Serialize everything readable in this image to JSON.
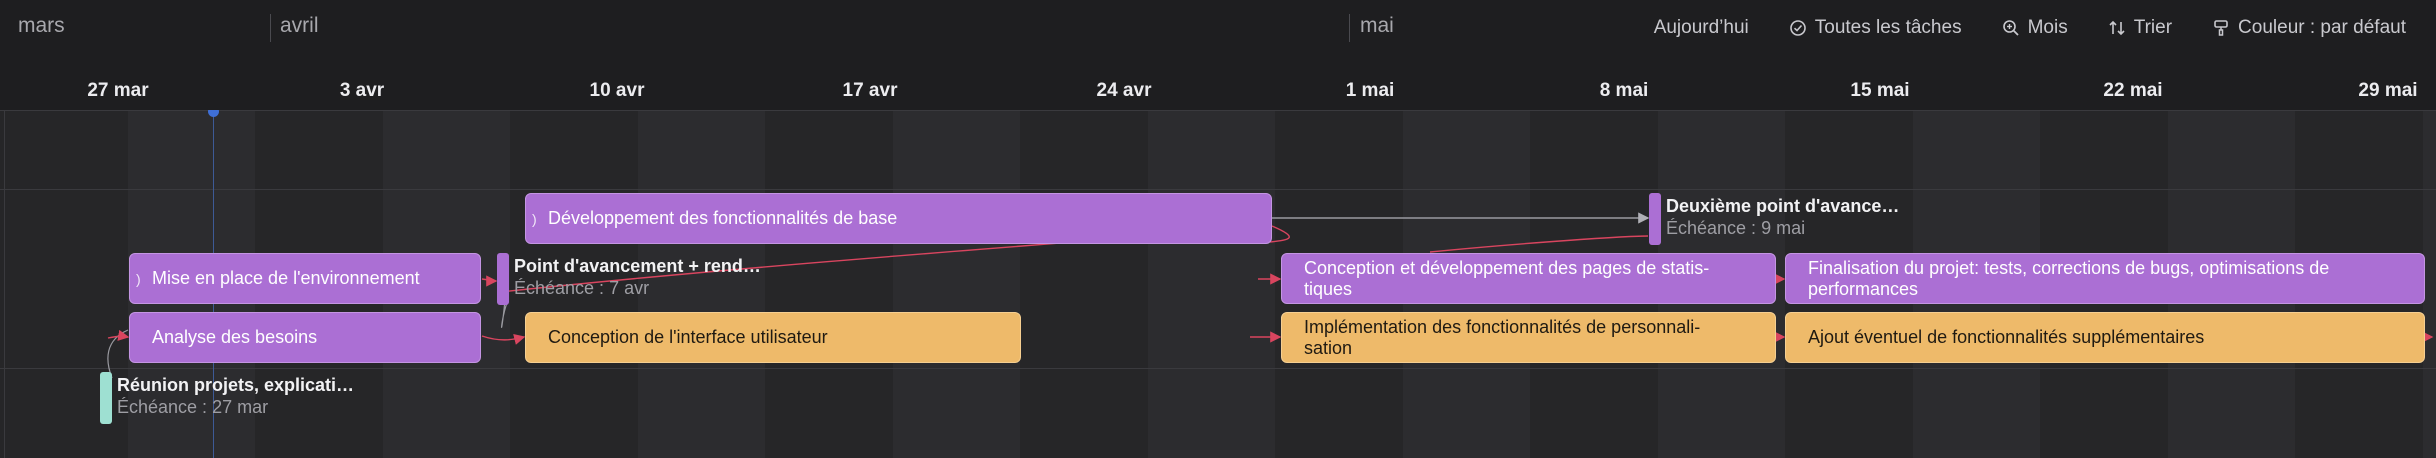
{
  "months": [
    {
      "label": "mars"
    },
    {
      "label": "avril"
    },
    {
      "label": "mai"
    }
  ],
  "toolbar": {
    "today": "Aujourd’hui",
    "all_tasks": "Toutes les tâches",
    "zoom": "Mois",
    "sort": "Trier",
    "color": "Couleur : par défaut"
  },
  "weeks": [
    "27 mar",
    "3 avr",
    "10 avr",
    "17 avr",
    "24 avr",
    "1 mai",
    "8 mai",
    "15 mai",
    "22 mai",
    "29 mai"
  ],
  "colors": {
    "background": "#1e1e20",
    "purple": "#ab6fd4",
    "orange": "#eeba6a",
    "teal": "#9ee0d2",
    "today": "#3f6fd6",
    "link_red": "#d9455f",
    "link_gray": "#9a9aa0"
  },
  "tasks": {
    "dev_base": "Développement des fonctionnalités de base",
    "setup_env": "Mise en place de l'environnement",
    "needs": "Analyse des besoins",
    "ui_design": "Conception de l'interface utilisateur",
    "stats_pages_l1": "Conception et développement des pages de statis-",
    "stats_pages_l2": "tiques",
    "finalisation_l1": "Finalisation du projet: tests, corrections de bugs, optimisations de",
    "finalisation_l2": "performances",
    "personalisation_l1": "Implémentation des fonctionnalités de personnali-",
    "personalisation_l2": "sation",
    "extra_features": "Ajout éventuel de fonctionnalités supplémentaires"
  },
  "milestones": {
    "second_checkpoint": {
      "title": "Deuxième point d'avance…",
      "due": "Échéance : 9 mai"
    },
    "checkpoint_render": {
      "title": "Point d'avancement + rend…",
      "due": "Échéance : 7 avr"
    },
    "kickoff_meeting": {
      "title": "Réunion projets, explicati…",
      "due": "Échéance : 27 mar"
    }
  }
}
